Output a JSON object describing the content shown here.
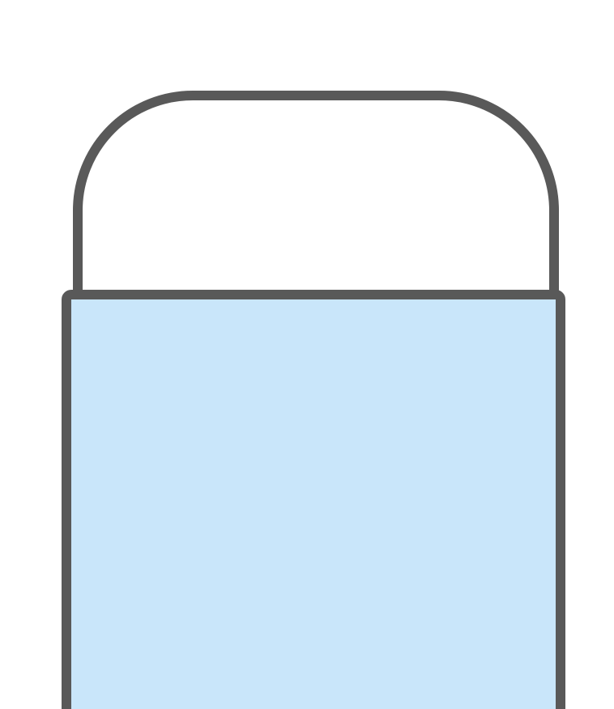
{
  "colors": {
    "background": "#ffffff",
    "outline": "#595959",
    "top_fill": "#ffffff",
    "body_fill": "#c9e6fa"
  },
  "shapes": [
    {
      "name": "rounded-top-cap",
      "fill": "top_fill"
    },
    {
      "name": "blue-body-rectangle",
      "fill": "body_fill"
    }
  ]
}
